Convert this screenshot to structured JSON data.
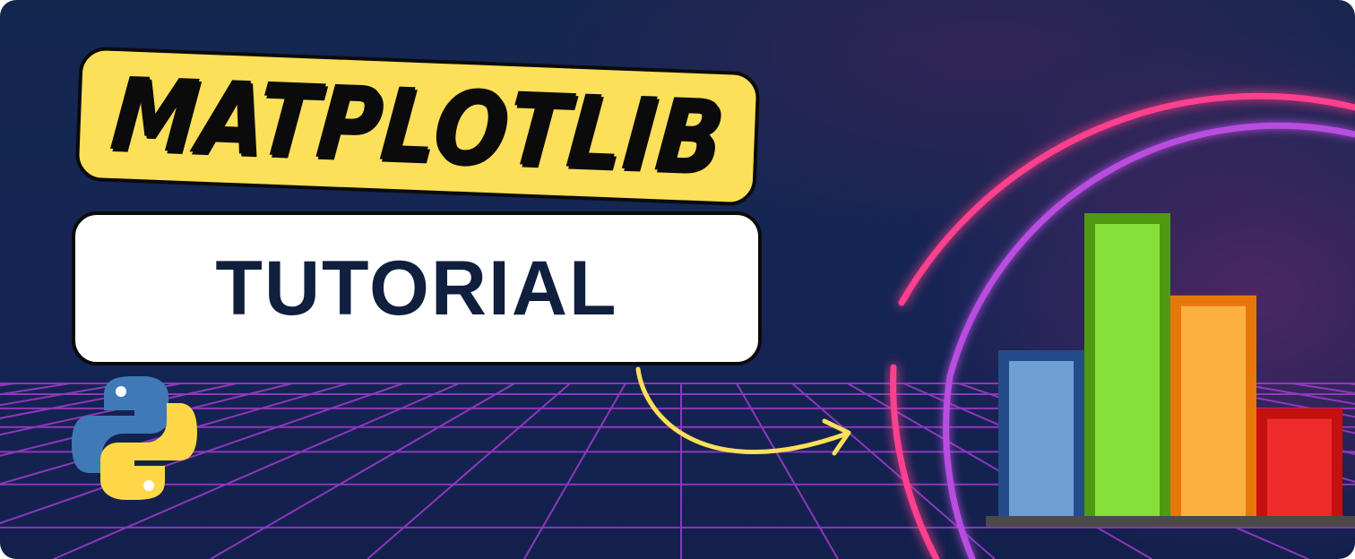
{
  "banner": {
    "title": "MATPLOTLIB",
    "subtitle": "TUTORIAL"
  },
  "colors": {
    "title_badge": "#fde05a",
    "subtitle_text": "#0f1f3d",
    "ring_outer": "#ff3f8e",
    "ring_inner": "#b94de0",
    "grid": "#a43bd0",
    "arrow": "#fde05a",
    "shelf": "#4a4a4a"
  },
  "icons": {
    "logo": "python-logo-icon",
    "arrow": "curved-arrow-icon"
  },
  "bar_illustration": {
    "bars": [
      {
        "level": 0.55,
        "fill": "#6f9fd2",
        "border": "#244c8a"
      },
      {
        "level": 1.0,
        "fill": "#86e03a",
        "border": "#4f9a10"
      },
      {
        "level": 0.73,
        "fill": "#fbb040",
        "border": "#e8770a"
      },
      {
        "level": 0.36,
        "fill": "#ee2b2b",
        "border": "#c51010"
      }
    ]
  }
}
